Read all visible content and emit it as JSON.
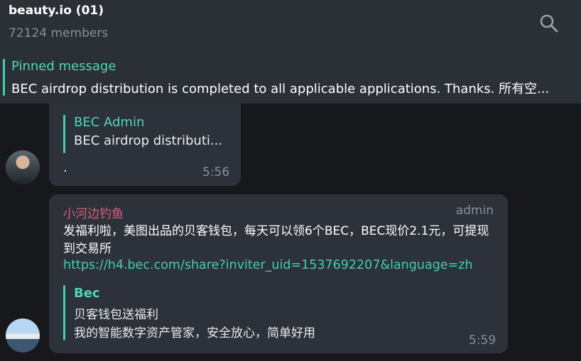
{
  "header": {
    "title": "beauty.io (01)",
    "members": "72124 members",
    "search_icon": "search-icon"
  },
  "pinned": {
    "label": "Pinned message",
    "text": "BEC airdrop distribution is completed to all applicable applications. Thanks.  所有空..."
  },
  "messages": [
    {
      "quote": {
        "title": "BEC Admin",
        "text": "BEC airdrop distributi..."
      },
      "text": ".",
      "time": "5:56"
    },
    {
      "sender": "小河边钓鱼",
      "role": "admin",
      "text": "发福利啦，美图出品的贝客钱包，每天可以领6个BEC，BEC现价2.1元，可提现到交易所",
      "link": "https://h4.bec.com/share?inviter_uid=1537692207&language=zh",
      "preview": {
        "title": "Bec",
        "line1": "贝客钱包送福利",
        "line2": "我的智能数字资产管家，安全放心，简单好用"
      },
      "time": "5:59"
    }
  ],
  "colors": {
    "accent": "#3fd0b0",
    "sender": "#d75f7d",
    "bubble": "#2d3139",
    "background": "#17181c"
  }
}
